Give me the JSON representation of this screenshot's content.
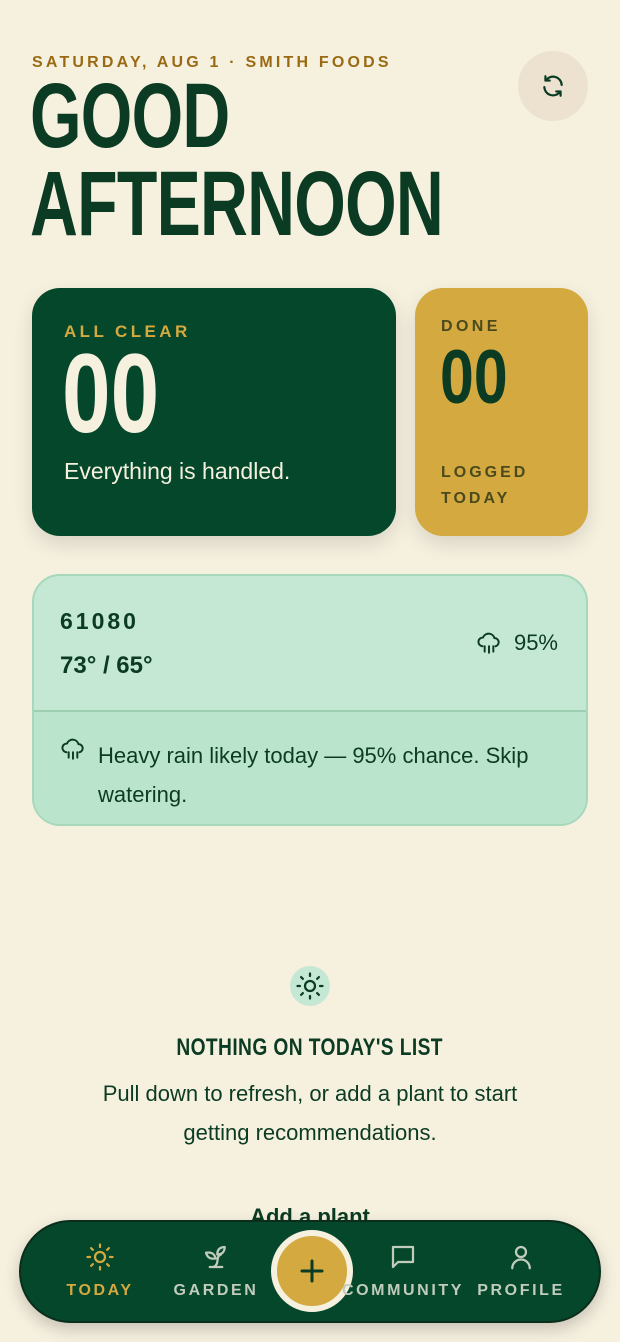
{
  "header": {
    "date_line": "SATURDAY, AUG 1 · SMITH FOODS",
    "greeting_line1": "GOOD",
    "greeting_line2": "AFTERNOON",
    "refresh_icon": "refresh-icon"
  },
  "summary": {
    "clear": {
      "eyebrow": "ALL CLEAR",
      "value": "00",
      "caption": "Everything is handled."
    },
    "done": {
      "eyebrow": "DONE",
      "value": "00",
      "foot_line1": "LOGGED",
      "foot_line2": "TODAY"
    }
  },
  "weather": {
    "zip": "61080",
    "temps": "73° / 65°",
    "rain_chance": "95%",
    "rain_icon": "rain-cloud-icon",
    "alert": "Heavy rain likely today — 95% chance. Skip watering."
  },
  "empty_state": {
    "icon": "sun-icon",
    "title": "NOTHING ON TODAY'S LIST",
    "body": "Pull down to refresh, or add a plant to start getting recommendations.",
    "action": "Add a plant"
  },
  "tabbar": {
    "tabs": [
      {
        "label": "TODAY",
        "icon": "sun-icon",
        "active": true
      },
      {
        "label": "GARDEN",
        "icon": "sprout-icon",
        "active": false
      },
      {
        "label": "COMMUNITY",
        "icon": "chat-bubble-icon",
        "active": false
      },
      {
        "label": "PROFILE",
        "icon": "user-icon",
        "active": false
      }
    ],
    "fab_icon": "plus-icon"
  },
  "colors": {
    "background": "#f6f0df",
    "dark_green": "#04472a",
    "gold": "#d4a93f",
    "mint": "#c4e8d3",
    "eyebrow_brown": "#9a6a12"
  }
}
